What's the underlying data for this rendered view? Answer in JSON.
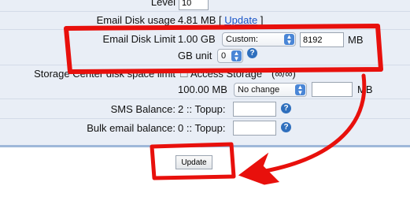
{
  "level": {
    "label": "Level",
    "value": "10"
  },
  "email_disk_usage": {
    "label": "Email Disk usage",
    "value": "4.81 MB [",
    "link": "Update",
    "suffix": "]"
  },
  "email_disk_limit": {
    "label": "Email Disk Limit",
    "value": "1.00 GB",
    "select": "Custom:",
    "input": "8192",
    "unit": "MB",
    "gb_unit_label": "GB unit",
    "gb_unit_value": "0"
  },
  "storage_center": {
    "label": "Storage Center disk space limit",
    "checkbox_label": "Access Storage",
    "checkbox_extra": "(∞/∞)",
    "value": "100.00 MB",
    "select": "No change",
    "unit": "MB"
  },
  "sms": {
    "label": "SMS Balance:",
    "value": "2 :: Topup:"
  },
  "bulk": {
    "label": "Bulk email balance:",
    "value": "0 :: Topup:"
  },
  "update_button": "Update",
  "colors": {
    "annotation": "#e8100c",
    "panel": "#e9eef6",
    "link": "#1a55c8"
  }
}
